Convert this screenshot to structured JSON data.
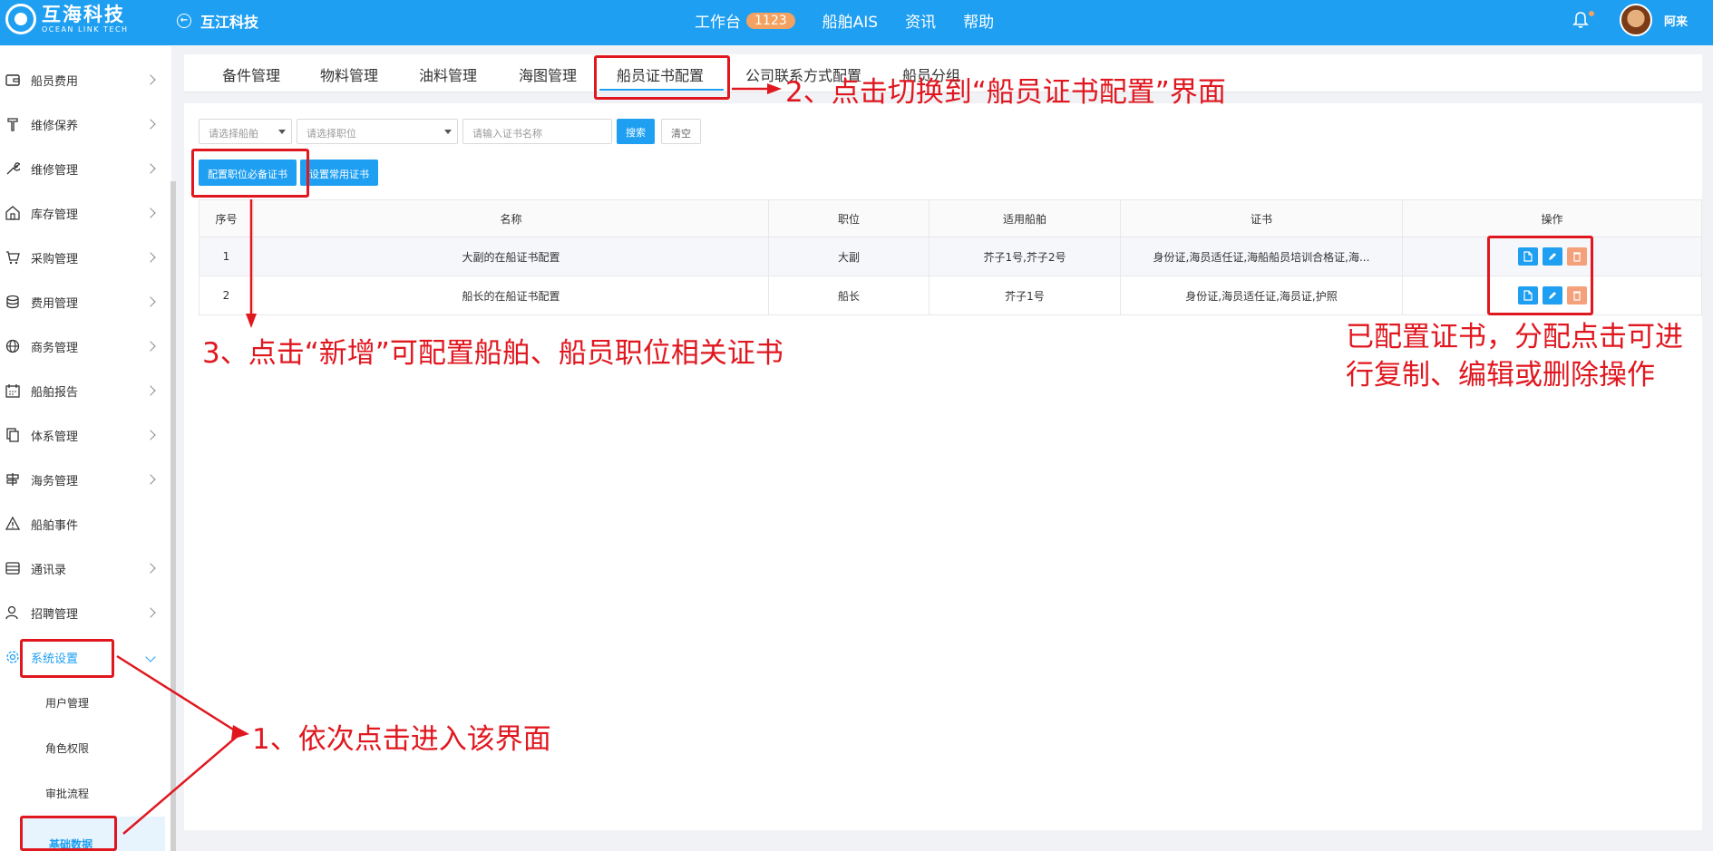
{
  "topbar": {
    "logo_cn": "互海科技",
    "logo_en": "OCEAN LINK TECH",
    "company": "互江科技",
    "nav": [
      {
        "label": "工作台",
        "badge": "1123"
      },
      {
        "label": "船舶AIS"
      },
      {
        "label": "资讯"
      },
      {
        "label": "帮助"
      }
    ],
    "username": "阿来"
  },
  "sidebar": {
    "items": [
      {
        "label": "船员费用",
        "icon": "wallet-icon"
      },
      {
        "label": "维修保养",
        "icon": "tool-icon"
      },
      {
        "label": "维修管理",
        "icon": "wrench-icon"
      },
      {
        "label": "库存管理",
        "icon": "warehouse-icon"
      },
      {
        "label": "采购管理",
        "icon": "cart-icon"
      },
      {
        "label": "费用管理",
        "icon": "coins-icon"
      },
      {
        "label": "商务管理",
        "icon": "globe-icon"
      },
      {
        "label": "船舶报告",
        "icon": "calendar-icon"
      },
      {
        "label": "体系管理",
        "icon": "documents-icon"
      },
      {
        "label": "海务管理",
        "icon": "signpost-icon"
      },
      {
        "label": "船舶事件",
        "icon": "warning-icon"
      },
      {
        "label": "通讯录",
        "icon": "contacts-icon"
      },
      {
        "label": "招聘管理",
        "icon": "user-search-icon"
      },
      {
        "label": "系统设置",
        "icon": "gear-icon"
      }
    ],
    "subitems": [
      "用户管理",
      "角色权限",
      "审批流程",
      "基础数据"
    ]
  },
  "tabs": [
    "备件管理",
    "物料管理",
    "油料管理",
    "海图管理",
    "船员证书配置",
    "公司联系方式配置",
    "船员分组"
  ],
  "filters": {
    "ship_placeholder": "请选择船舶",
    "position_placeholder": "请选择职位",
    "cert_placeholder": "请输入证书名称",
    "search_label": "搜索",
    "clear_label": "清空"
  },
  "actions": {
    "config_required": "配置职位必备证书",
    "set_common": "设置常用证书"
  },
  "table": {
    "headers": [
      "序号",
      "名称",
      "职位",
      "适用船舶",
      "证书",
      "操作"
    ],
    "rows": [
      {
        "no": "1",
        "name": "大副的在船证书配置",
        "position": "大副",
        "ships": "芥子1号,芥子2号",
        "certs": "身份证,海员适任证,海船船员培训合格证,海..."
      },
      {
        "no": "2",
        "name": "船长的在船证书配置",
        "position": "船长",
        "ships": "芥子1号",
        "certs": "身份证,海员适任证,海员证,护照"
      }
    ]
  },
  "annotations": {
    "step1": "1、依次点击进入该界面",
    "step2": "2、点击切换到“船员证书配置”界面",
    "step3": "3、点击“新增”可配置船舶、船员职位相关证书",
    "ops_note_1": "已配置证书，分配点击可进",
    "ops_note_2": "行复制、编辑或删除操作"
  },
  "colors": {
    "primary": "#1e9ff2",
    "annotation": "#e0171f",
    "badge": "#f4a261",
    "delete": "#f4a07a"
  }
}
